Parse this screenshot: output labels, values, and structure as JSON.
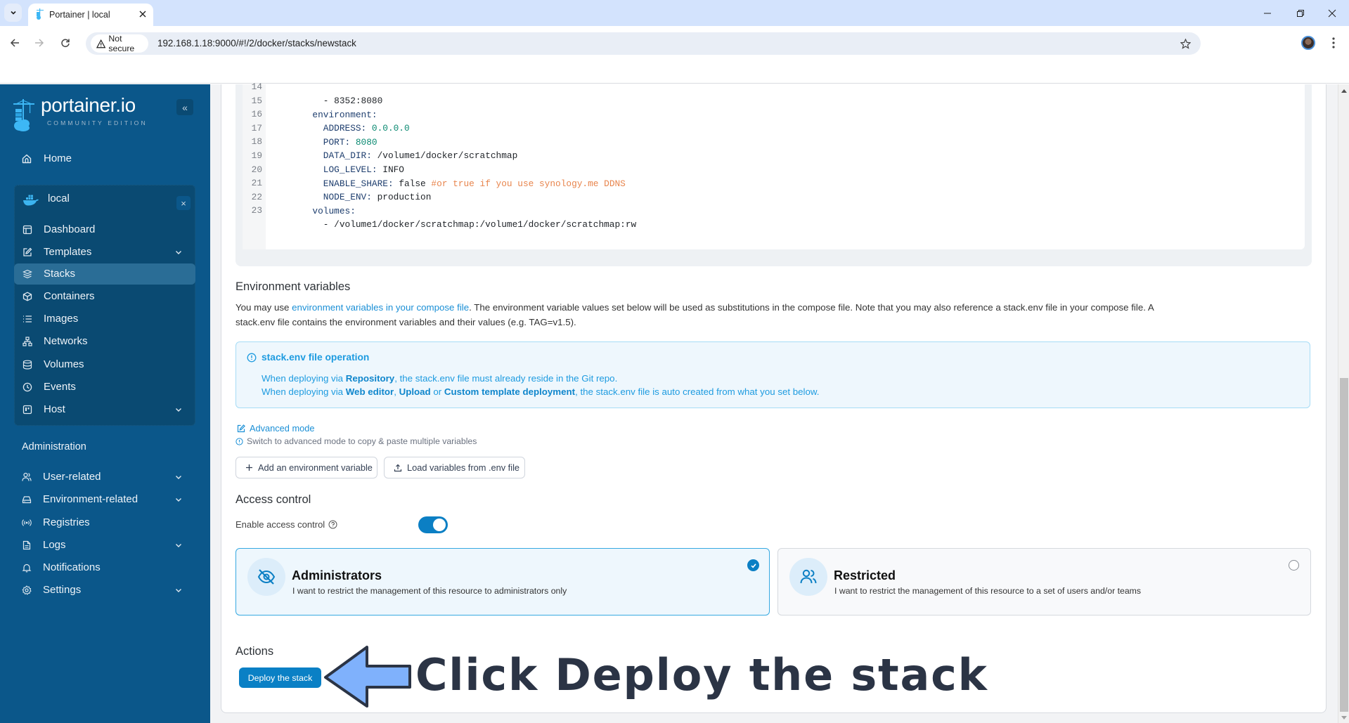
{
  "browser": {
    "tab_title": "Portainer | local",
    "tab_close_glyph": "×",
    "security_label": "Not secure",
    "url": "192.168.1.18:9000/#!/2/docker/stacks/newstack"
  },
  "sidebar": {
    "logo_text": "portainer.io",
    "logo_subtitle": "COMMUNITY EDITION",
    "collapse_glyph": "«",
    "home": {
      "label": "Home",
      "icon": "home-icon"
    },
    "environment": {
      "name": "local",
      "close_glyph": "×",
      "items": [
        {
          "label": "Dashboard",
          "icon": "dashboard-icon",
          "expandable": false
        },
        {
          "label": "Templates",
          "icon": "templates-icon",
          "expandable": true
        },
        {
          "label": "Stacks",
          "icon": "stacks-icon",
          "expandable": false,
          "active": true
        },
        {
          "label": "Containers",
          "icon": "containers-icon",
          "expandable": false
        },
        {
          "label": "Images",
          "icon": "images-icon",
          "expandable": false
        },
        {
          "label": "Networks",
          "icon": "networks-icon",
          "expandable": false
        },
        {
          "label": "Volumes",
          "icon": "volumes-icon",
          "expandable": false
        },
        {
          "label": "Events",
          "icon": "events-icon",
          "expandable": false
        },
        {
          "label": "Host",
          "icon": "host-icon",
          "expandable": true
        }
      ]
    },
    "admin_heading": "Administration",
    "admin_items": [
      {
        "label": "User-related",
        "icon": "users-icon",
        "expandable": true
      },
      {
        "label": "Environment-related",
        "icon": "hard-drive-icon",
        "expandable": true
      },
      {
        "label": "Registries",
        "icon": "radio-icon",
        "expandable": false
      },
      {
        "label": "Logs",
        "icon": "file-text-icon",
        "expandable": true
      },
      {
        "label": "Notifications",
        "icon": "bell-icon",
        "expandable": false
      },
      {
        "label": "Settings",
        "icon": "gear-icon",
        "expandable": true
      }
    ]
  },
  "editor": {
    "lines": [
      {
        "num": "14",
        "tokens": [
          {
            "text": "      - 8352:8080",
            "kind": "plain"
          }
        ]
      },
      {
        "num": "15",
        "tokens": [
          {
            "text": "    environment:",
            "kind": "key"
          }
        ]
      },
      {
        "num": "16",
        "tokens": [
          {
            "text": "      ADDRESS:",
            "kind": "key"
          },
          {
            "text": " 0.0.0.0",
            "kind": "number"
          }
        ]
      },
      {
        "num": "17",
        "tokens": [
          {
            "text": "      PORT:",
            "kind": "key"
          },
          {
            "text": " 8080",
            "kind": "number"
          }
        ]
      },
      {
        "num": "18",
        "tokens": [
          {
            "text": "      DATA_DIR:",
            "kind": "key"
          },
          {
            "text": " /volume1/docker/scratchmap",
            "kind": "plain"
          }
        ]
      },
      {
        "num": "19",
        "tokens": [
          {
            "text": "      LOG_LEVEL:",
            "kind": "key"
          },
          {
            "text": " INFO",
            "kind": "plain"
          }
        ]
      },
      {
        "num": "20",
        "tokens": [
          {
            "text": "      ENABLE_SHARE:",
            "kind": "key"
          },
          {
            "text": " false ",
            "kind": "plain"
          },
          {
            "text": "#or true if you use synology.me DDNS",
            "kind": "comment"
          }
        ]
      },
      {
        "num": "21",
        "tokens": [
          {
            "text": "      NODE_ENV:",
            "kind": "key"
          },
          {
            "text": " production",
            "kind": "plain"
          }
        ]
      },
      {
        "num": "22",
        "tokens": [
          {
            "text": "    volumes:",
            "kind": "key"
          }
        ]
      },
      {
        "num": "23",
        "tokens": [
          {
            "text": "      - /volume1/docker/scratchmap:/volume1/docker/scratchmap:rw",
            "kind": "plain"
          }
        ]
      }
    ]
  },
  "env_vars": {
    "heading": "Environment variables",
    "intro_line1": {
      "before": "You may use ",
      "link": "environment variables in your compose file",
      "after": ". The environment variable values set below will be used as substitutions in the compose file. Note that you may also reference a stack.env file in your compose file. A"
    },
    "intro_line2": "stack.env file contains the environment variables and their values (e.g. TAG=v1.5).",
    "info": {
      "title": "stack.env file operation",
      "line1": [
        {
          "text": "When deploying via ",
          "bold": false
        },
        {
          "text": "Repository",
          "bold": true
        },
        {
          "text": ", the stack.env file must already reside in the Git repo.",
          "bold": false
        }
      ],
      "line2": [
        {
          "text": "When deploying via ",
          "bold": false
        },
        {
          "text": "Web editor",
          "bold": true
        },
        {
          "text": ", ",
          "bold": false
        },
        {
          "text": "Upload",
          "bold": true
        },
        {
          "text": " or ",
          "bold": false
        },
        {
          "text": "Custom template deployment",
          "bold": true
        },
        {
          "text": ", the stack.env file is auto created from what you set below.",
          "bold": false
        }
      ]
    },
    "advanced_mode_label": "Advanced mode",
    "advanced_mode_hint": "Switch to advanced mode to copy & paste multiple variables",
    "add_variable_label": "Add an environment variable",
    "load_env_label": "Load variables from .env file"
  },
  "access_control": {
    "heading": "Access control",
    "enable_label": "Enable access control",
    "enabled": true,
    "options": [
      {
        "title": "Administrators",
        "description": "I want to restrict the management of this resource to administrators only",
        "selected": true
      },
      {
        "title": "Restricted",
        "description": "I want to restrict the management of this resource to a set of users and/or teams",
        "selected": false
      }
    ]
  },
  "actions": {
    "heading": "Actions",
    "deploy_label": "Deploy the stack"
  },
  "annotation": {
    "text": "Click Deploy the stack"
  },
  "colors": {
    "sidebar": "#0b578a",
    "sidebar_active": "#2a6d96",
    "accent": "#0a80c5",
    "info": "#1d9be0",
    "annotation_arrow": "#7fb1fc",
    "annotation_text": "#2b3445"
  }
}
